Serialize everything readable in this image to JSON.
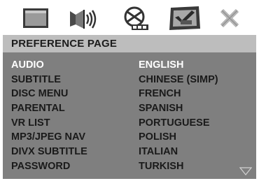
{
  "toolbar": {
    "tabs": [
      {
        "icon": "monitor-icon",
        "name": "general-setup"
      },
      {
        "icon": "speaker-icon",
        "name": "audio-setup"
      },
      {
        "icon": "dolby-digital-icon",
        "name": "dolby-setup"
      },
      {
        "icon": "preference-monitor-icon",
        "name": "preference-setup",
        "selected": true
      },
      {
        "icon": "close-icon",
        "name": "exit"
      }
    ]
  },
  "header": {
    "title": "PREFERENCE PAGE"
  },
  "menu": {
    "items": [
      "AUDIO",
      "SUBTITLE",
      "DISC MENU",
      "PARENTAL",
      "VR LIST",
      "MP3/JPEG NAV",
      "DIVX SUBTITLE",
      "PASSWORD"
    ],
    "selected_index": 0
  },
  "options": {
    "items": [
      "ENGLISH",
      "CHINESE (SIMP)",
      "FRENCH",
      "SPANISH",
      "PORTUGUESE",
      "POLISH",
      "ITALIAN",
      "TURKISH"
    ],
    "selected_index": 0
  },
  "colors": {
    "header_bg": "#bdbdbd",
    "panel_bg": "#7f7f7f",
    "active_text": "#ffffff",
    "text": "#1a1a1a"
  }
}
